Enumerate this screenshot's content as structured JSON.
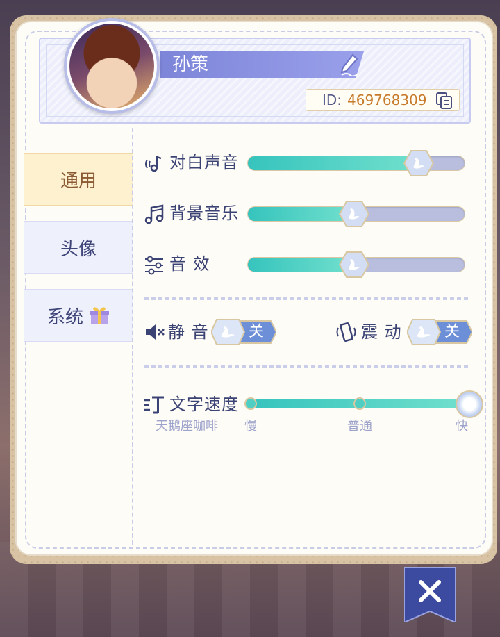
{
  "profile": {
    "name": "孙策",
    "id_label": "ID:",
    "id_value": "469768309"
  },
  "tabs": [
    {
      "label": "通用",
      "active": true
    },
    {
      "label": "头像",
      "active": false
    },
    {
      "label": "系统",
      "active": false
    }
  ],
  "audio": {
    "voice_label": "对白声音",
    "voice_level": 0.79,
    "music_label": "背景音乐",
    "music_level": 0.49,
    "sfx_label": "音 效",
    "sfx_level": 0.49
  },
  "toggles": {
    "mute_label": "静 音",
    "mute_state": "关",
    "vibrate_label": "震 动",
    "vibrate_state": "关"
  },
  "text_speed": {
    "label": "文字速度",
    "font_name": "天鹅座咖啡",
    "ticks": [
      "慢",
      "普通",
      "快"
    ],
    "selected": "快"
  },
  "colors": {
    "accent": "#7d85d9",
    "fill": "#36c4bd",
    "id_value": "#c77a2c"
  },
  "icons": {
    "edit": "pen-icon",
    "copy": "copy-icon",
    "gift": "gift-icon",
    "close": "close-icon"
  }
}
